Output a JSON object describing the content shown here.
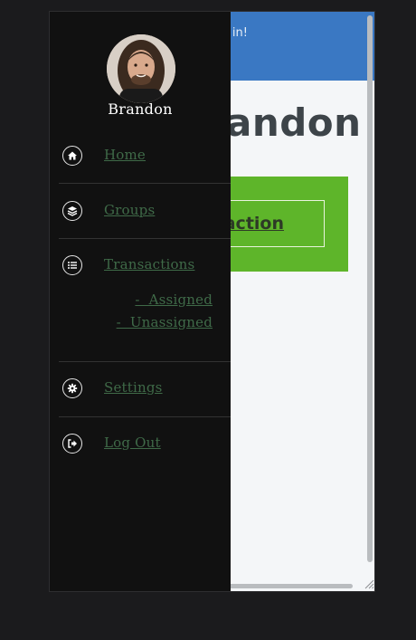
{
  "app": {
    "heading": "andon",
    "card_button_label": "action",
    "toast": "Logged in!",
    "colors": {
      "header": "#3a78c3",
      "card": "#5eb52a",
      "drawer": "#111111",
      "link": "#3f6a48"
    }
  },
  "drawer": {
    "profile_name": "Brandon",
    "items": [
      {
        "label": "Home",
        "icon": "home-icon"
      },
      {
        "label": "Groups",
        "icon": "layers-icon"
      },
      {
        "label": "Transactions",
        "icon": "list-icon"
      },
      {
        "label": "Settings",
        "icon": "gear-icon"
      },
      {
        "label": "Log Out",
        "icon": "sign-out-icon"
      }
    ],
    "transaction_subitems": [
      {
        "label": "-  Assigned"
      },
      {
        "label": "-  Unassigned"
      }
    ]
  }
}
